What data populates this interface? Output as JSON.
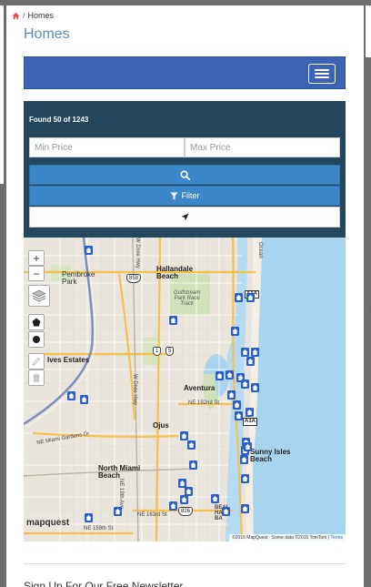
{
  "breadcrumb": {
    "separator": "/",
    "current": "Homes"
  },
  "page": {
    "title": "Homes"
  },
  "search": {
    "found_text": "Found 50 of 1243",
    "min_price_placeholder": "Min Price",
    "max_price_placeholder": "Max Price",
    "filter_label": "Filter"
  },
  "map": {
    "zoom_in": "+",
    "zoom_out": "−",
    "labels": {
      "pembroke_park": "Pembroke\nPark",
      "hallandale_beach": "Hallandale\nBeach",
      "gulfstream_park": "Gulfstream\nPark Race\nTrack",
      "ives_estates": "Ives Estates",
      "aventura": "Aventura",
      "ne_192nd": "NE 192nd St",
      "ojus": "Ojus",
      "ne_miami_gardens": "NE Miami Gardens Dr",
      "north_miami_beach": "North Miami\nBeach",
      "sunny_isles": "Sunny Isles\nBeach",
      "ne_163rd": "NE 163rd St",
      "ne_159th": "NE 159th St",
      "bal_harbour": "BEAL\nHAA\nBA",
      "w_dixie": "W Dixie Hwy",
      "dixie_hwy": "W Dixie Hwy",
      "ne_19th": "NE 19th Ave",
      "w_ocean": "Ocean",
      "shield_858": "858",
      "shield_1": "1",
      "shield_5": "5",
      "shield_826": "826",
      "shield_a1a_top": "A1A",
      "shield_a1a_mid": "A1A"
    },
    "logo": "mapquest",
    "attribution": "©2015 MapQuest · Some data ©2015 TomTom |",
    "terms": "Terms"
  },
  "footer": {
    "newsletter_heading": "Sign Up For Our Free Newsletter"
  },
  "colors": {
    "title": "#5b8db8",
    "navbar": "#3d63b5",
    "search_panel": "#23475d",
    "primary_button": "#3b87c9",
    "water": "#a8d4f0",
    "highway": "#f2c14e",
    "pin": "#2b5fc7"
  }
}
